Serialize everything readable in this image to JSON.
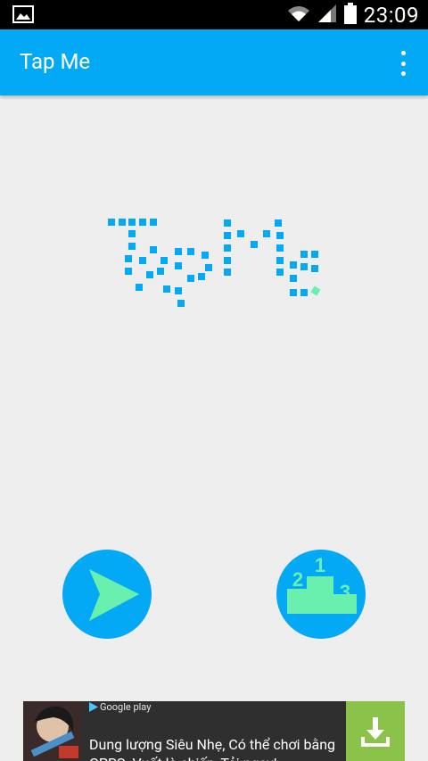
{
  "status_bar": {
    "time": "23:09"
  },
  "app_bar": {
    "title": "Tap Me"
  },
  "logo": {
    "text": "TapMe"
  },
  "buttons": {
    "play_icon": "play-icon",
    "leaderboard_icon": "podium-icon",
    "podium_numbers": [
      "1",
      "2",
      "3"
    ]
  },
  "ad": {
    "store_label": "Google play",
    "text": "Dung lượng Siêu Nhẹ, Có thể chơi bằng GPRS. Vuốt là chiến, Tải ngay!"
  },
  "colors": {
    "primary": "#03a9f4",
    "accent": "#69f0ae",
    "background": "#eeeeee",
    "ad_button": "#8bc34a"
  }
}
